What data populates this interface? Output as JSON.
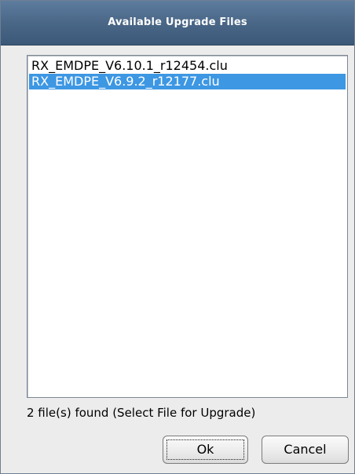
{
  "dialog": {
    "title": "Available Upgrade Files"
  },
  "files": {
    "items": [
      {
        "label": "RX_EMDPE_V6.10.1_r12454.clu",
        "selected": false
      },
      {
        "label": "RX_EMDPE_V6.9.2_r12177.clu",
        "selected": true
      }
    ]
  },
  "status": {
    "text": "2 file(s) found (Select File for Upgrade)"
  },
  "buttons": {
    "ok_label": "Ok",
    "cancel_label": "Cancel"
  },
  "colors": {
    "titlebar": "#4a6787",
    "selection": "#3d97e3",
    "dialog_bg": "#ececec"
  }
}
